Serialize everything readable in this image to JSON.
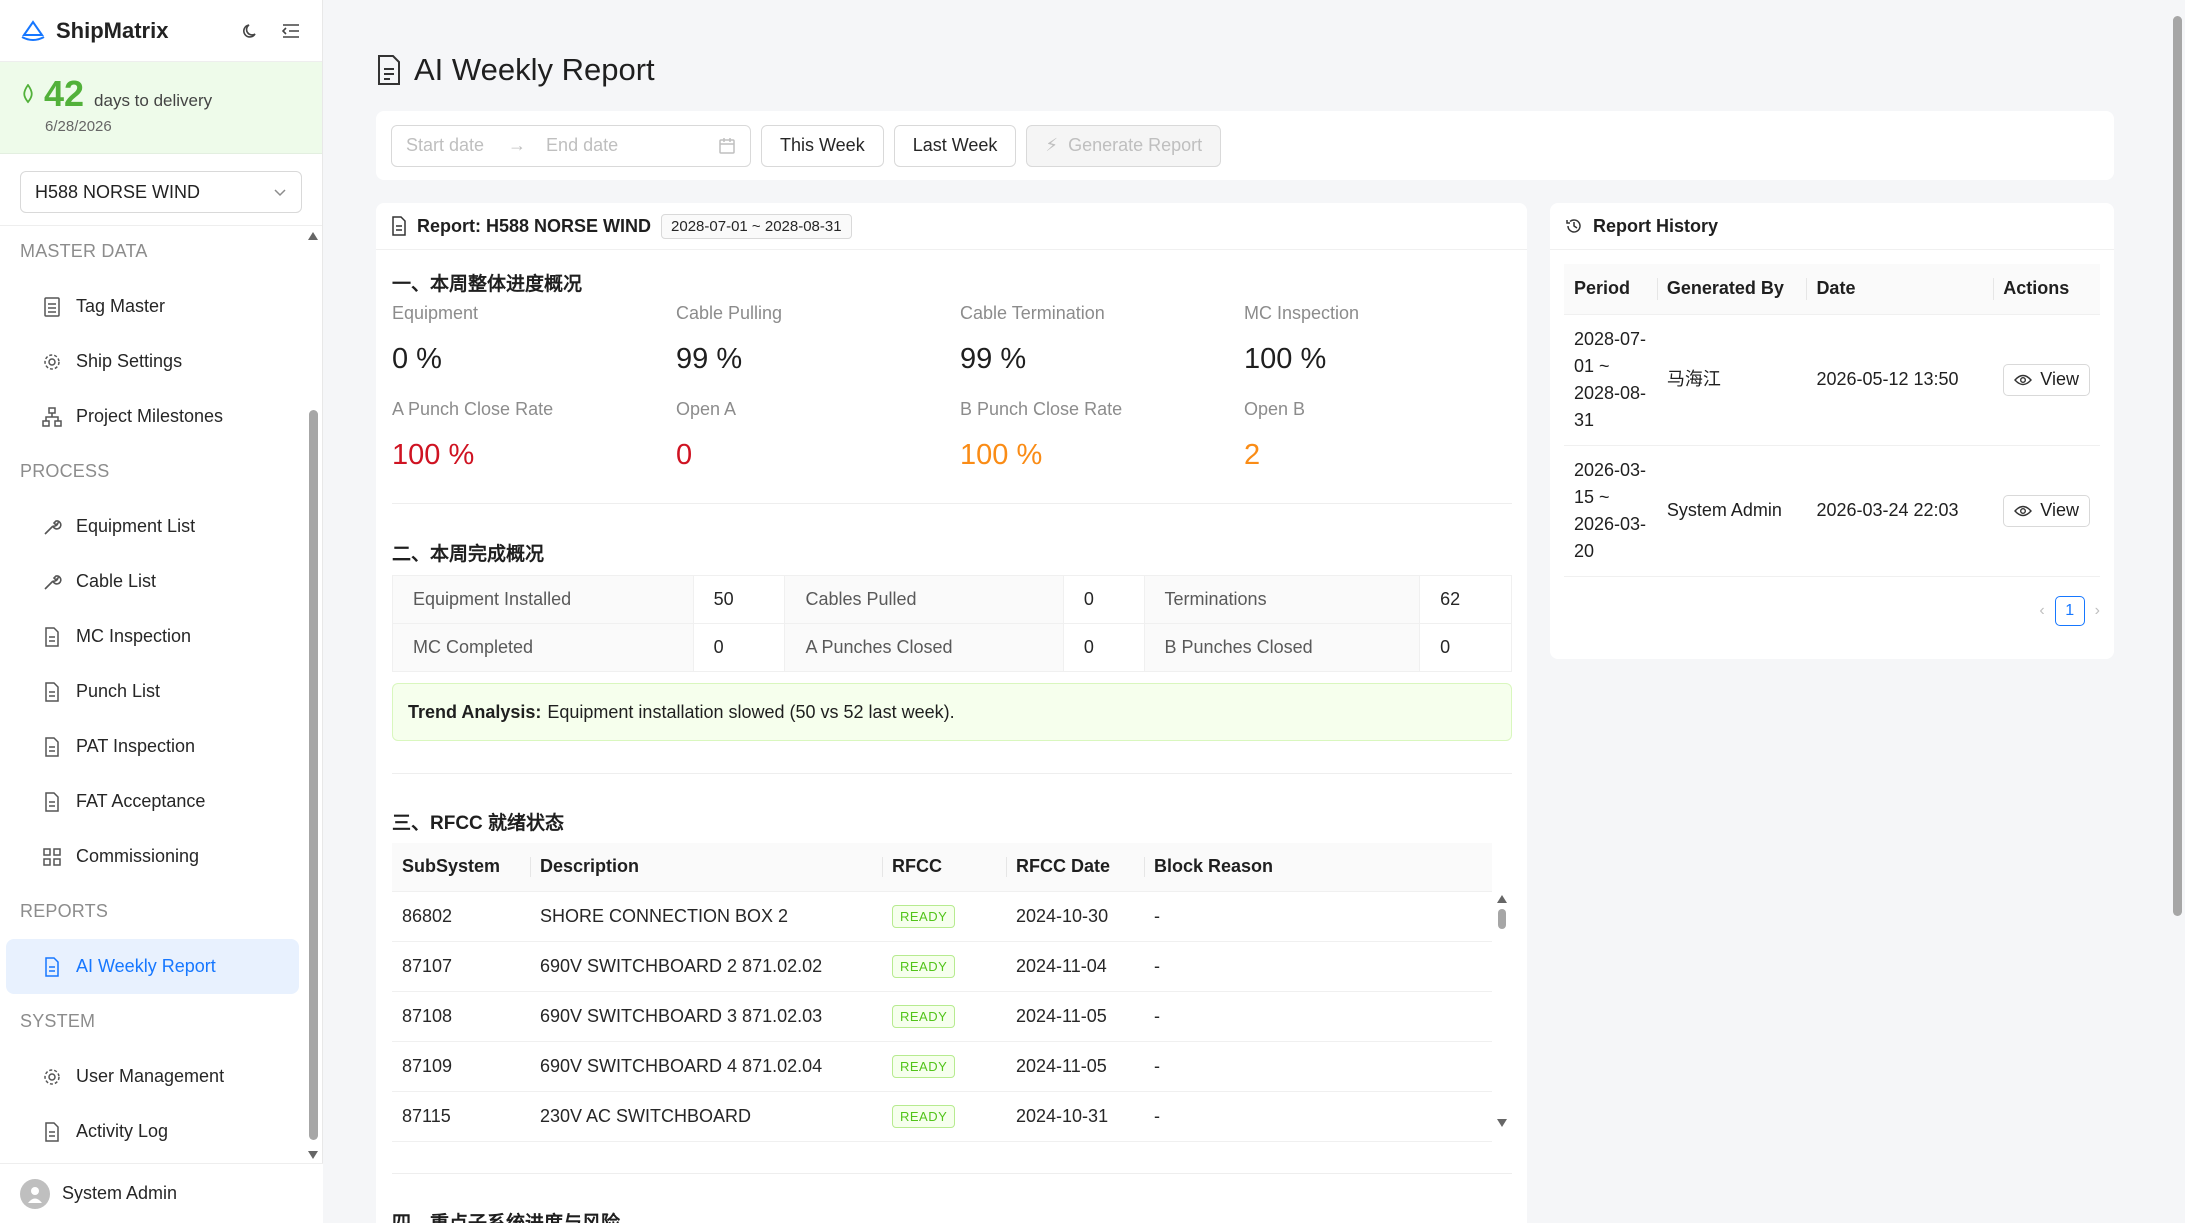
{
  "app": {
    "name": "ShipMatrix"
  },
  "delivery": {
    "days": "42",
    "label": "days to delivery",
    "date": "6/28/2026"
  },
  "ship_selector": {
    "value": "H588 NORSE WIND"
  },
  "menu": {
    "sections": [
      {
        "title": "MASTER DATA",
        "items": [
          {
            "label": "Tag Master",
            "icon": "list-icon"
          },
          {
            "label": "Ship Settings",
            "icon": "gear-icon"
          },
          {
            "label": "Project Milestones",
            "icon": "hierarchy-icon"
          }
        ]
      },
      {
        "title": "PROCESS",
        "items": [
          {
            "label": "Equipment List",
            "icon": "tool-icon"
          },
          {
            "label": "Cable List",
            "icon": "tool-icon"
          },
          {
            "label": "MC Inspection",
            "icon": "document-icon"
          },
          {
            "label": "Punch List",
            "icon": "document-icon"
          },
          {
            "label": "PAT Inspection",
            "icon": "document-icon"
          },
          {
            "label": "FAT Acceptance",
            "icon": "document-icon"
          },
          {
            "label": "Commissioning",
            "icon": "grid-icon"
          }
        ]
      },
      {
        "title": "REPORTS",
        "items": [
          {
            "label": "AI Weekly Report",
            "icon": "document-icon",
            "active": true
          }
        ]
      },
      {
        "title": "SYSTEM",
        "items": [
          {
            "label": "User Management",
            "icon": "gear-icon"
          },
          {
            "label": "Activity Log",
            "icon": "document-icon"
          }
        ]
      }
    ]
  },
  "user": {
    "name": "System Admin"
  },
  "page": {
    "title": "AI Weekly Report"
  },
  "toolbar": {
    "start_placeholder": "Start date",
    "end_placeholder": "End date",
    "this_week": "This Week",
    "last_week": "Last Week",
    "generate": "Generate Report"
  },
  "report": {
    "title": "Report: H588 NORSE WIND",
    "period": "2028-07-01 ~ 2028-08-31",
    "section1": "一、本周整体进度概况",
    "metrics_row1": [
      {
        "label": "Equipment",
        "value": "0 %"
      },
      {
        "label": "Cable Pulling",
        "value": "99 %"
      },
      {
        "label": "Cable Termination",
        "value": "99 %"
      },
      {
        "label": "MC Inspection",
        "value": "100 %"
      }
    ],
    "metrics_row2": [
      {
        "label": "A Punch Close Rate",
        "value": "100 %",
        "color": "#cf1322"
      },
      {
        "label": "Open A",
        "value": "0",
        "color": "#cf1322"
      },
      {
        "label": "B Punch Close Rate",
        "value": "100 %",
        "color": "#fa8c16"
      },
      {
        "label": "Open B",
        "value": "2",
        "color": "#fa8c16"
      }
    ],
    "section2": "二、本周完成概况",
    "summary": [
      [
        {
          "k": "Equipment Installed",
          "v": "50"
        },
        {
          "k": "Cables Pulled",
          "v": "0"
        },
        {
          "k": "Terminations",
          "v": "62"
        }
      ],
      [
        {
          "k": "MC Completed",
          "v": "0"
        },
        {
          "k": "A Punches Closed",
          "v": "0"
        },
        {
          "k": "B Punches Closed",
          "v": "0"
        }
      ]
    ],
    "trend_label": "Trend Analysis:",
    "trend_text": "Equipment installation slowed (50 vs 52 last week).",
    "section3": "三、RFCC 就绪状态",
    "rfcc_headers": [
      "SubSystem",
      "Description",
      "RFCC",
      "RFCC Date",
      "Block Reason"
    ],
    "rfcc_rows": [
      [
        "86802",
        "SHORE CONNECTION BOX 2",
        "READY",
        "2024-10-30",
        "-"
      ],
      [
        "87107",
        "690V SWITCHBOARD 2 871.02.02",
        "READY",
        "2024-11-04",
        "-"
      ],
      [
        "87108",
        "690V SWITCHBOARD 3 871.02.03",
        "READY",
        "2024-11-05",
        "-"
      ],
      [
        "87109",
        "690V SWITCHBOARD 4 871.02.04",
        "READY",
        "2024-11-05",
        "-"
      ],
      [
        "87115",
        "230V AC SWITCHBOARD",
        "READY",
        "2024-10-31",
        "-"
      ]
    ],
    "section4": "四、重点子系统进度与风险"
  },
  "history": {
    "title": "Report History",
    "headers": [
      "Period",
      "Generated By",
      "Date",
      "Actions"
    ],
    "rows": [
      {
        "period": [
          "2028-07-",
          "01 ~",
          "2028-08-",
          "31"
        ],
        "by": "马海江",
        "date": "2026-05-12 13:50",
        "action": "View"
      },
      {
        "period": [
          "2026-03-",
          "15 ~",
          "2026-03-",
          "20"
        ],
        "by": "System Admin",
        "date": "2026-03-24 22:03",
        "action": "View"
      }
    ],
    "page": "1"
  }
}
